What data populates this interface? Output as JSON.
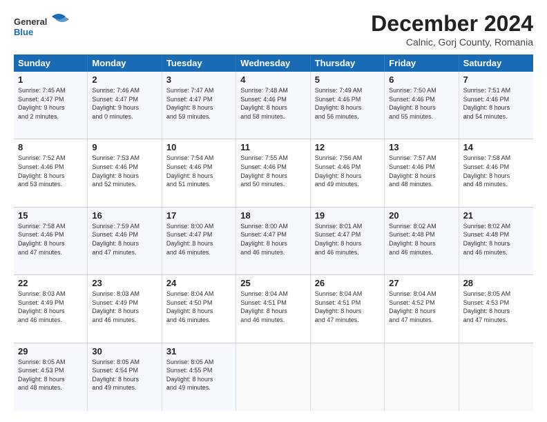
{
  "header": {
    "logo_general": "General",
    "logo_blue": "Blue",
    "month": "December 2024",
    "location": "Calnic, Gorj County, Romania"
  },
  "weekdays": [
    "Sunday",
    "Monday",
    "Tuesday",
    "Wednesday",
    "Thursday",
    "Friday",
    "Saturday"
  ],
  "weeks": [
    [
      {
        "day": "1",
        "info": "Sunrise: 7:45 AM\nSunset: 4:47 PM\nDaylight: 9 hours\nand 2 minutes."
      },
      {
        "day": "2",
        "info": "Sunrise: 7:46 AM\nSunset: 4:47 PM\nDaylight: 9 hours\nand 0 minutes."
      },
      {
        "day": "3",
        "info": "Sunrise: 7:47 AM\nSunset: 4:47 PM\nDaylight: 8 hours\nand 59 minutes."
      },
      {
        "day": "4",
        "info": "Sunrise: 7:48 AM\nSunset: 4:46 PM\nDaylight: 8 hours\nand 58 minutes."
      },
      {
        "day": "5",
        "info": "Sunrise: 7:49 AM\nSunset: 4:46 PM\nDaylight: 8 hours\nand 56 minutes."
      },
      {
        "day": "6",
        "info": "Sunrise: 7:50 AM\nSunset: 4:46 PM\nDaylight: 8 hours\nand 55 minutes."
      },
      {
        "day": "7",
        "info": "Sunrise: 7:51 AM\nSunset: 4:46 PM\nDaylight: 8 hours\nand 54 minutes."
      }
    ],
    [
      {
        "day": "8",
        "info": "Sunrise: 7:52 AM\nSunset: 4:46 PM\nDaylight: 8 hours\nand 53 minutes."
      },
      {
        "day": "9",
        "info": "Sunrise: 7:53 AM\nSunset: 4:46 PM\nDaylight: 8 hours\nand 52 minutes."
      },
      {
        "day": "10",
        "info": "Sunrise: 7:54 AM\nSunset: 4:46 PM\nDaylight: 8 hours\nand 51 minutes."
      },
      {
        "day": "11",
        "info": "Sunrise: 7:55 AM\nSunset: 4:46 PM\nDaylight: 8 hours\nand 50 minutes."
      },
      {
        "day": "12",
        "info": "Sunrise: 7:56 AM\nSunset: 4:46 PM\nDaylight: 8 hours\nand 49 minutes."
      },
      {
        "day": "13",
        "info": "Sunrise: 7:57 AM\nSunset: 4:46 PM\nDaylight: 8 hours\nand 48 minutes."
      },
      {
        "day": "14",
        "info": "Sunrise: 7:58 AM\nSunset: 4:46 PM\nDaylight: 8 hours\nand 48 minutes."
      }
    ],
    [
      {
        "day": "15",
        "info": "Sunrise: 7:58 AM\nSunset: 4:46 PM\nDaylight: 8 hours\nand 47 minutes."
      },
      {
        "day": "16",
        "info": "Sunrise: 7:59 AM\nSunset: 4:46 PM\nDaylight: 8 hours\nand 47 minutes."
      },
      {
        "day": "17",
        "info": "Sunrise: 8:00 AM\nSunset: 4:47 PM\nDaylight: 8 hours\nand 46 minutes."
      },
      {
        "day": "18",
        "info": "Sunrise: 8:00 AM\nSunset: 4:47 PM\nDaylight: 8 hours\nand 46 minutes."
      },
      {
        "day": "19",
        "info": "Sunrise: 8:01 AM\nSunset: 4:47 PM\nDaylight: 8 hours\nand 46 minutes."
      },
      {
        "day": "20",
        "info": "Sunrise: 8:02 AM\nSunset: 4:48 PM\nDaylight: 8 hours\nand 46 minutes."
      },
      {
        "day": "21",
        "info": "Sunrise: 8:02 AM\nSunset: 4:48 PM\nDaylight: 8 hours\nand 46 minutes."
      }
    ],
    [
      {
        "day": "22",
        "info": "Sunrise: 8:03 AM\nSunset: 4:49 PM\nDaylight: 8 hours\nand 46 minutes."
      },
      {
        "day": "23",
        "info": "Sunrise: 8:03 AM\nSunset: 4:49 PM\nDaylight: 8 hours\nand 46 minutes."
      },
      {
        "day": "24",
        "info": "Sunrise: 8:04 AM\nSunset: 4:50 PM\nDaylight: 8 hours\nand 46 minutes."
      },
      {
        "day": "25",
        "info": "Sunrise: 8:04 AM\nSunset: 4:51 PM\nDaylight: 8 hours\nand 46 minutes."
      },
      {
        "day": "26",
        "info": "Sunrise: 8:04 AM\nSunset: 4:51 PM\nDaylight: 8 hours\nand 47 minutes."
      },
      {
        "day": "27",
        "info": "Sunrise: 8:04 AM\nSunset: 4:52 PM\nDaylight: 8 hours\nand 47 minutes."
      },
      {
        "day": "28",
        "info": "Sunrise: 8:05 AM\nSunset: 4:53 PM\nDaylight: 8 hours\nand 47 minutes."
      }
    ],
    [
      {
        "day": "29",
        "info": "Sunrise: 8:05 AM\nSunset: 4:53 PM\nDaylight: 8 hours\nand 48 minutes."
      },
      {
        "day": "30",
        "info": "Sunrise: 8:05 AM\nSunset: 4:54 PM\nDaylight: 8 hours\nand 49 minutes."
      },
      {
        "day": "31",
        "info": "Sunrise: 8:05 AM\nSunset: 4:55 PM\nDaylight: 8 hours\nand 49 minutes."
      },
      {
        "day": "",
        "info": ""
      },
      {
        "day": "",
        "info": ""
      },
      {
        "day": "",
        "info": ""
      },
      {
        "day": "",
        "info": ""
      }
    ]
  ]
}
